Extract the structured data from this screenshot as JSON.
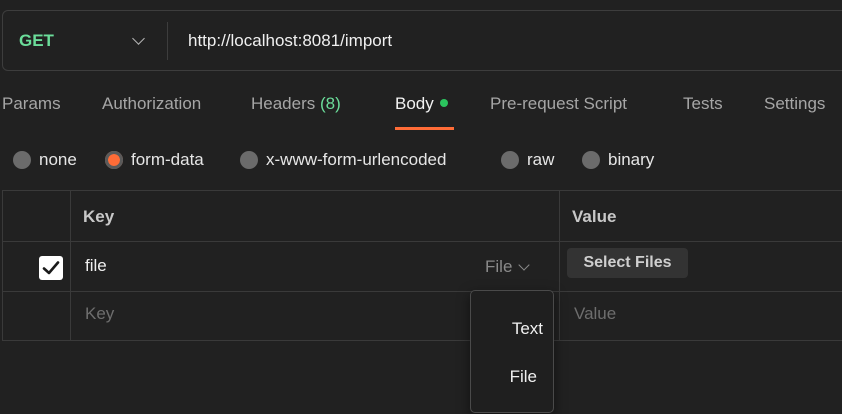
{
  "request": {
    "method": "GET",
    "url": "http://localhost:8081/import"
  },
  "tabs": [
    {
      "label": "Params"
    },
    {
      "label": "Authorization"
    },
    {
      "label": "Headers",
      "count": "(8)"
    },
    {
      "label": "Body",
      "active": true
    },
    {
      "label": "Pre-request Script"
    },
    {
      "label": "Tests"
    },
    {
      "label": "Settings"
    }
  ],
  "body_types": [
    {
      "label": "none"
    },
    {
      "label": "form-data",
      "selected": true
    },
    {
      "label": "x-www-form-urlencoded"
    },
    {
      "label": "raw"
    },
    {
      "label": "binary"
    }
  ],
  "table": {
    "key_header": "Key",
    "value_header": "Value",
    "rows": [
      {
        "checked": true,
        "key": "file",
        "type": "File",
        "value_button": "Select Files"
      }
    ],
    "new_row": {
      "key_placeholder": "Key",
      "value_placeholder": "Value"
    }
  },
  "type_dropdown": {
    "options": [
      "Text",
      "File"
    ]
  },
  "colors": {
    "accent": "#ff6c37",
    "method_green": "#6bdd9a",
    "dot_green": "#2bc45e",
    "background": "#212121"
  }
}
